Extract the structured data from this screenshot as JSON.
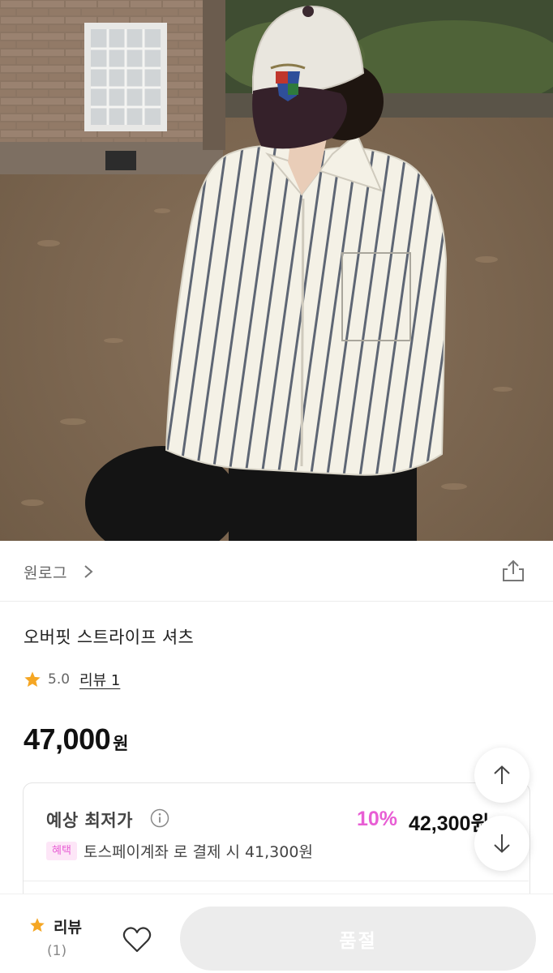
{
  "brand": {
    "name": "원로그"
  },
  "product": {
    "title": "오버핏 스트라이프 셔츠",
    "rating": "5.0",
    "review_link": "리뷰 1",
    "price": "47,000",
    "price_unit": "원"
  },
  "lowest_price": {
    "label": "예상 최저가",
    "discount": "10%",
    "price": "42,300원",
    "badge": "혜택",
    "benefit": "토스페이계좌 로 결제 시 41,300원"
  },
  "bottom_bar": {
    "review_label": "리뷰",
    "review_count": "(1)",
    "buy_button": "품절"
  },
  "colors": {
    "accent_pink": "#e85ed4",
    "star": "#f5a623",
    "disabled_button": "#ececec"
  },
  "icons": [
    "chevron-right-icon",
    "share-icon",
    "star-icon",
    "info-icon",
    "arrow-up-icon",
    "arrow-down-icon",
    "heart-icon"
  ]
}
